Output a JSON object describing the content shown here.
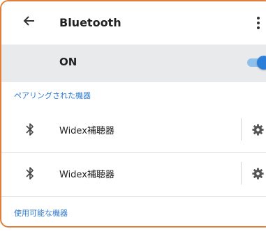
{
  "header": {
    "title": "Bluetooth",
    "back_icon": "arrow-left-icon",
    "more_icon": "more-vertical-icon"
  },
  "master_switch": {
    "label": "ON",
    "state": "on",
    "accent_color": "#2c7fd8"
  },
  "sections": {
    "paired_header": "ペアリングされた機器",
    "available_header": "使用可能な機器",
    "header_color": "#2f79d1"
  },
  "paired_devices": [
    {
      "name": "Widex補聴器",
      "icon": "bluetooth-icon",
      "settings_icon": "gear-icon"
    },
    {
      "name": "Widex補聴器",
      "icon": "bluetooth-icon",
      "settings_icon": "gear-icon"
    }
  ],
  "colors": {
    "frame_border": "#e07f3d",
    "master_row_bg": "#e9eaec"
  }
}
